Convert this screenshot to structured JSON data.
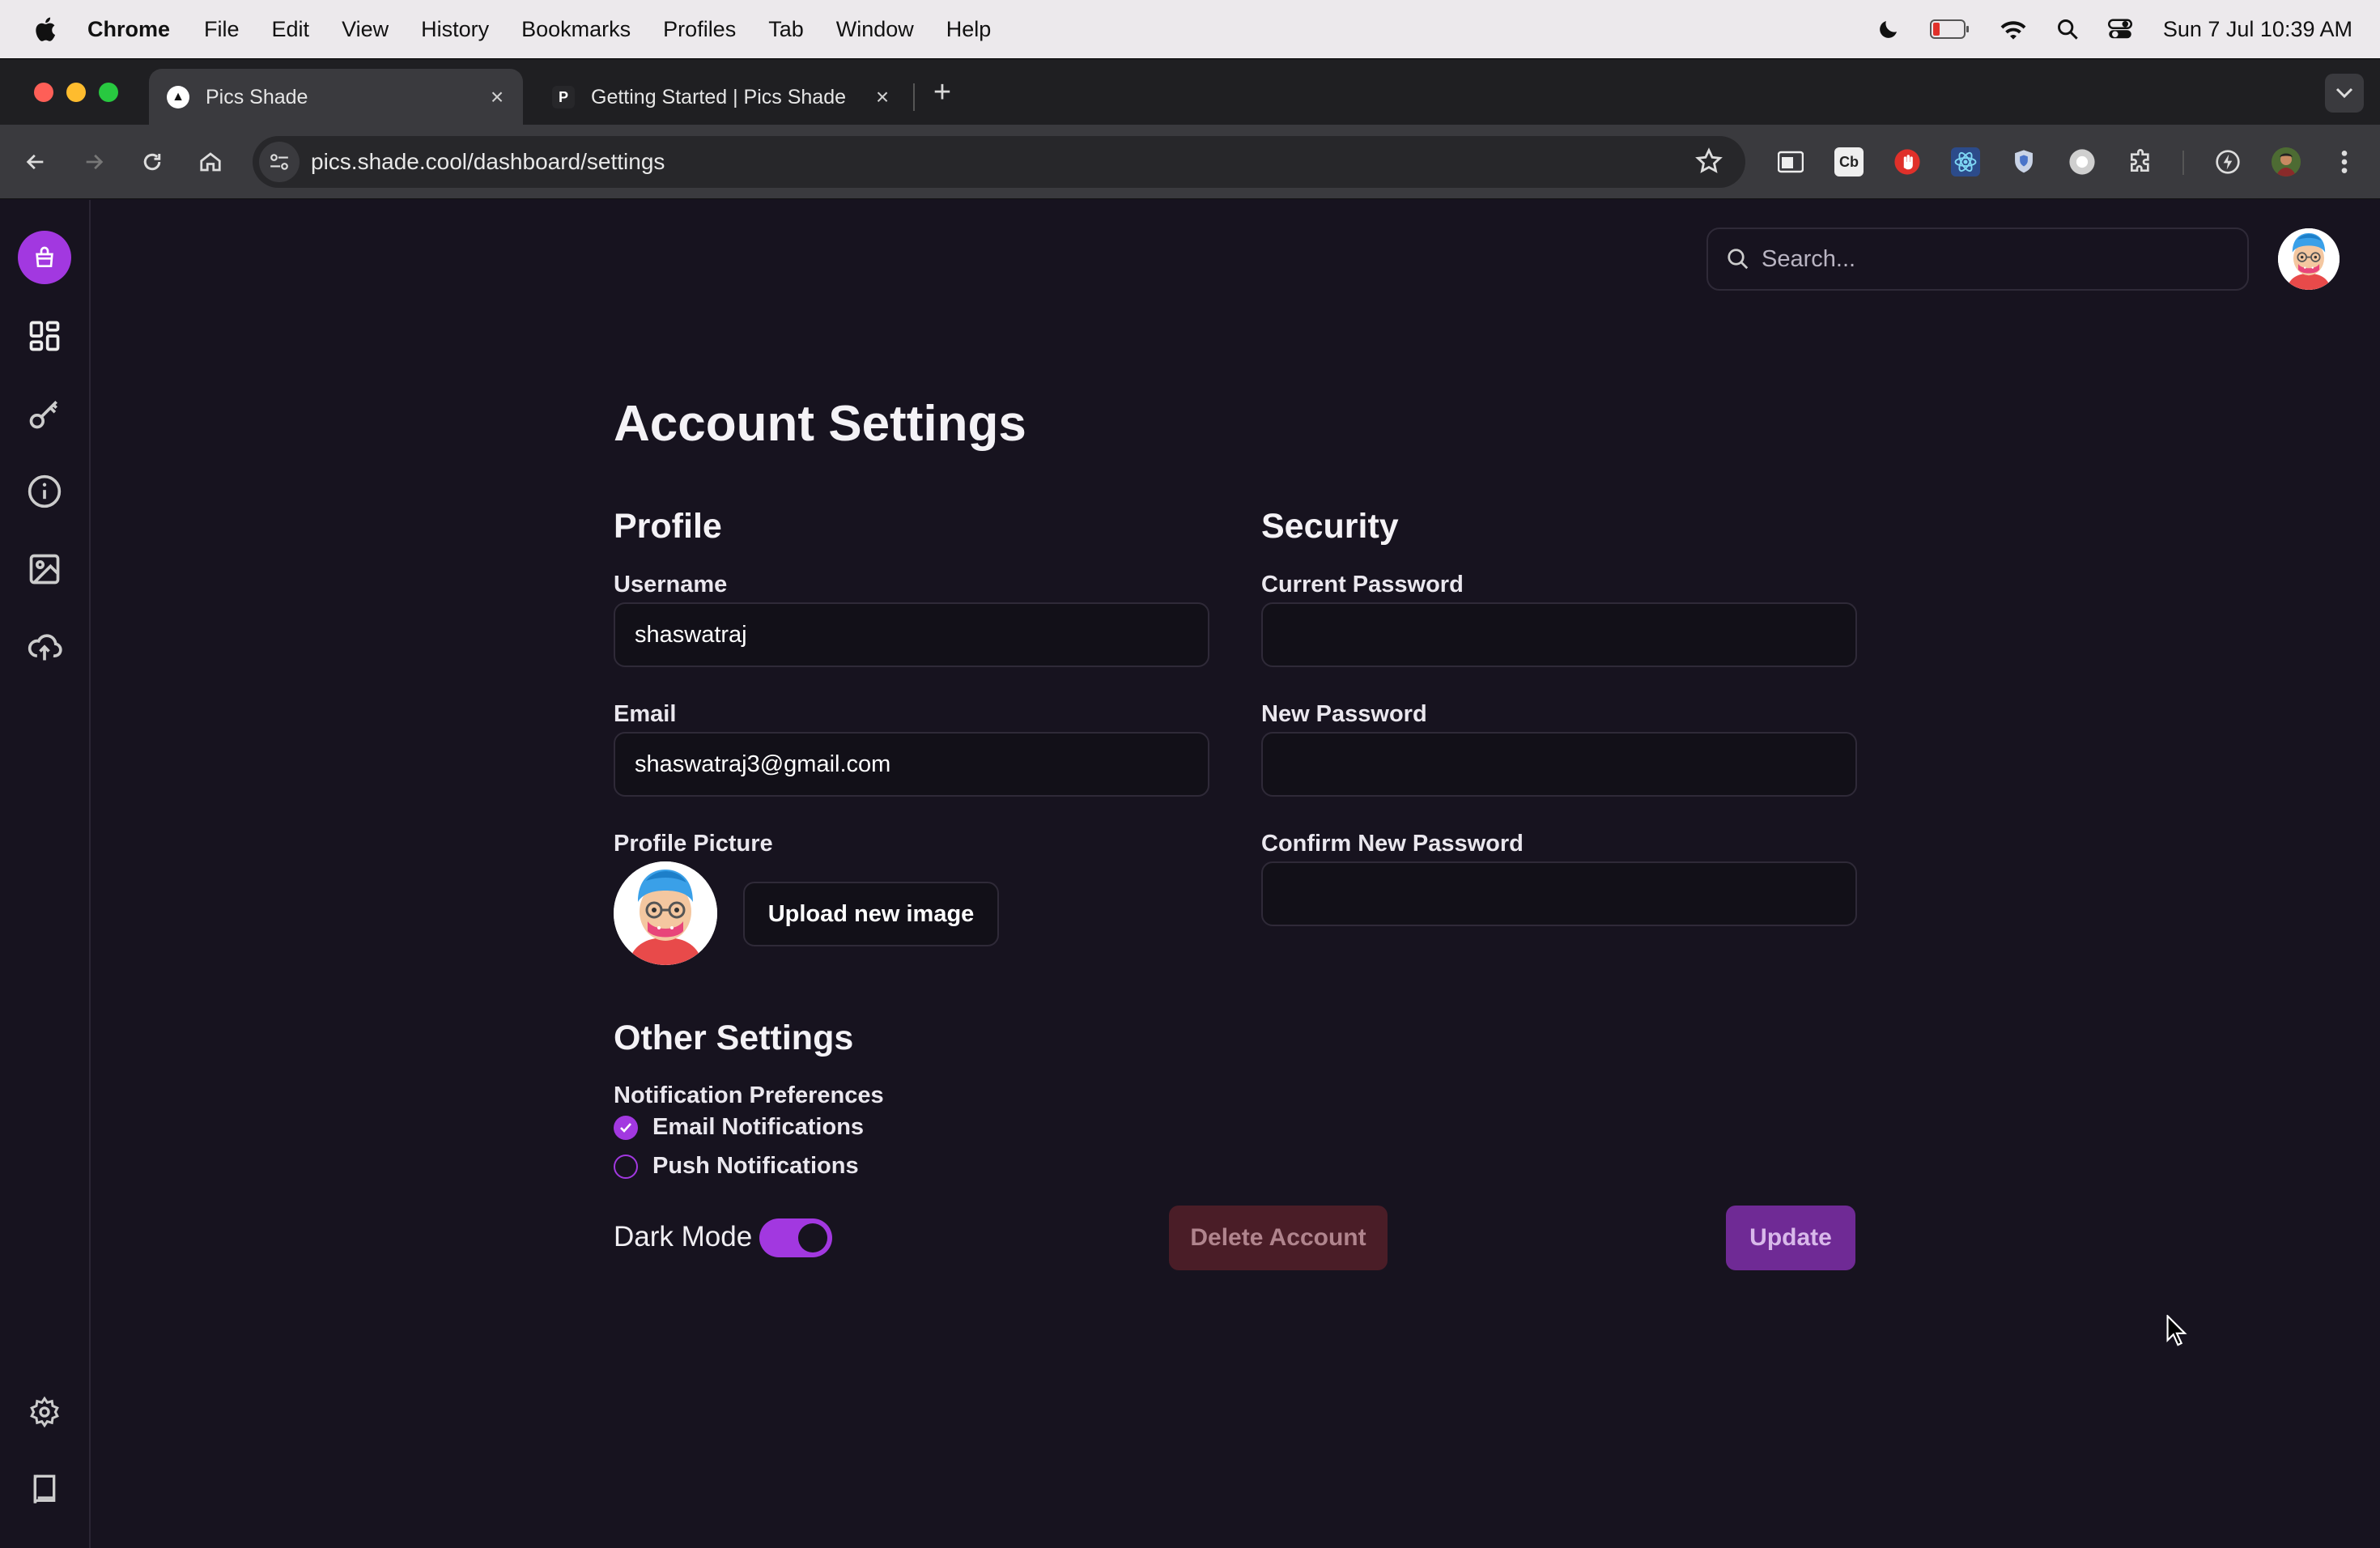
{
  "menubar": {
    "app_name": "Chrome",
    "menus": [
      "File",
      "Edit",
      "View",
      "History",
      "Bookmarks",
      "Profiles",
      "Tab",
      "Window",
      "Help"
    ],
    "clock": "Sun 7 Jul  10:39 AM",
    "status_icons": [
      "moon-icon",
      "battery-icon",
      "wifi-icon",
      "spotlight-search-icon",
      "control-center-icon"
    ]
  },
  "browser": {
    "tabs": [
      {
        "title": "Pics Shade",
        "favicon": "▲",
        "active": true
      },
      {
        "title": "Getting Started | Pics Shade",
        "favicon": "P",
        "active": false
      }
    ],
    "url": "pics.shade.cool/dashboard/settings",
    "extensions": [
      "reader-mode-icon",
      "cb-extension-icon",
      "adblock-icon",
      "react-devtools-icon",
      "shield-extension-icon",
      "record-extension-icon",
      "puzzle-extensions-icon",
      "performance-icon",
      "profile-avatar-icon",
      "more-menu-icon"
    ]
  },
  "sidebar": {
    "items": [
      "logo-icon",
      "dashboard-icon",
      "key-icon",
      "info-icon",
      "image-icon",
      "cloud-upload-icon"
    ],
    "bottom_items": [
      "settings-gear-icon",
      "docs-book-icon"
    ]
  },
  "header": {
    "search_placeholder": "Search..."
  },
  "page": {
    "title": "Account Settings",
    "profile": {
      "heading": "Profile",
      "username_label": "Username",
      "username_value": "shaswatraj",
      "email_label": "Email",
      "email_value": "shaswatraj3@gmail.com",
      "picture_label": "Profile Picture",
      "upload_label": "Upload new image"
    },
    "security": {
      "heading": "Security",
      "current_password_label": "Current Password",
      "new_password_label": "New Password",
      "confirm_password_label": "Confirm New Password"
    },
    "other": {
      "heading": "Other Settings",
      "notification_heading": "Notification Preferences",
      "email_notifications_label": "Email Notifications",
      "email_notifications_checked": true,
      "push_notifications_label": "Push Notifications",
      "push_notifications_checked": false,
      "dark_mode_label": "Dark Mode",
      "dark_mode_on": true,
      "delete_label": "Delete Account",
      "update_label": "Update"
    }
  },
  "colors": {
    "background": "#17131f",
    "accent": "#a238e0",
    "delete_bg": "#4a1d27",
    "update_bg": "#6f2a95"
  }
}
